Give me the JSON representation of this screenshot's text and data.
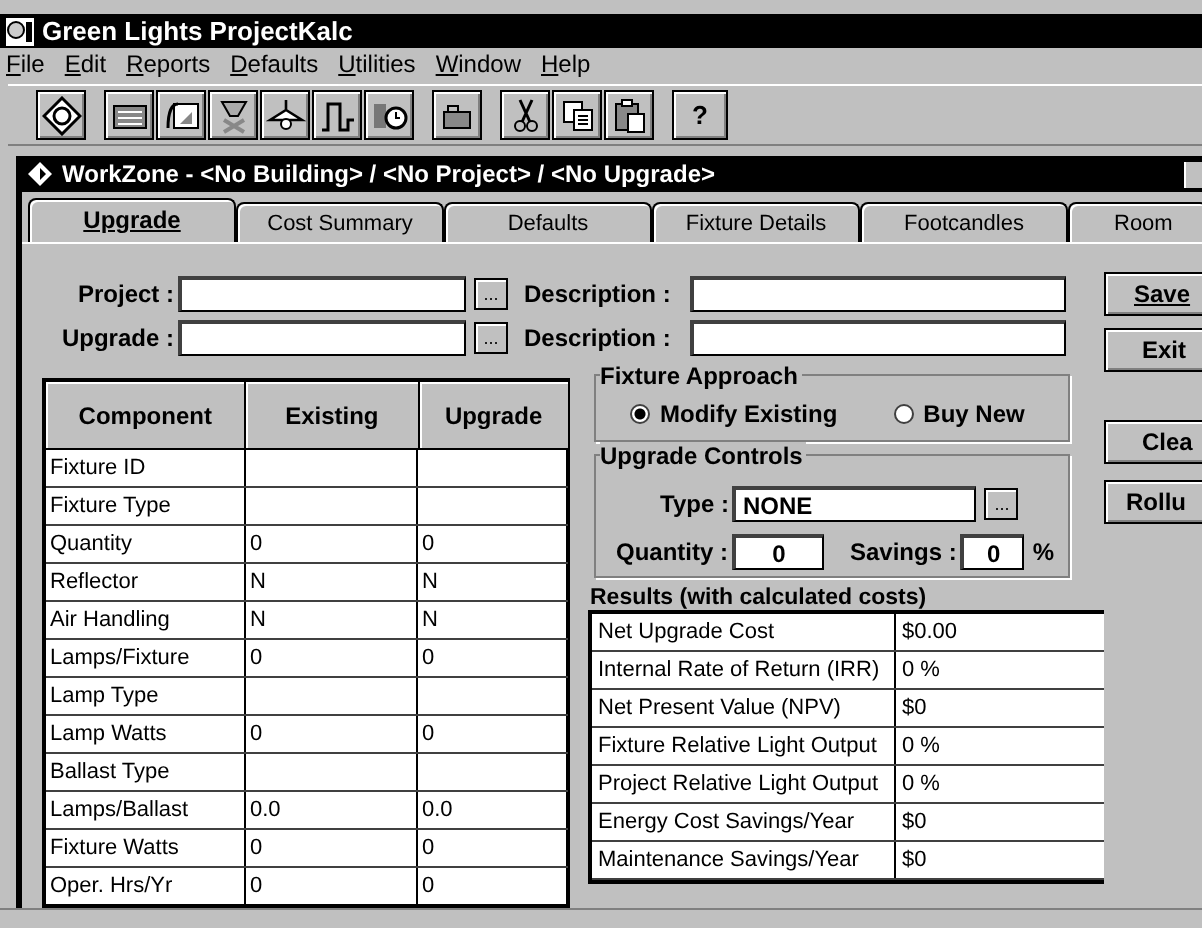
{
  "app": {
    "title": "Green Lights ProjectKalc"
  },
  "menu": [
    {
      "label": "File"
    },
    {
      "label": "Edit"
    },
    {
      "label": "Reports"
    },
    {
      "label": "Defaults"
    },
    {
      "label": "Utilities"
    },
    {
      "label": "Window"
    },
    {
      "label": "Help"
    }
  ],
  "toolbar": {
    "help": "?"
  },
  "workzone": {
    "title": "WorkZone - <No Building> / <No Project> / <No Upgrade>"
  },
  "tabs": [
    {
      "label": "Upgrade",
      "selected": true
    },
    {
      "label": "Cost Summary",
      "selected": false
    },
    {
      "label": "Defaults",
      "selected": false
    },
    {
      "label": "Fixture Details",
      "selected": false
    },
    {
      "label": "Footcandles",
      "selected": false
    },
    {
      "label": "Room",
      "selected": false
    }
  ],
  "form": [
    {
      "label": "Project :",
      "browse": "...",
      "desc_label": "Description :"
    },
    {
      "label": "Upgrade :",
      "browse": "...",
      "desc_label": "Description :"
    }
  ],
  "buttons": [
    {
      "label": "Save"
    },
    {
      "label": "Exit"
    },
    {
      "label": "Clea"
    },
    {
      "label": "Rollu"
    }
  ],
  "component_table": {
    "columns": [
      "Component",
      "Existing",
      "Upgrade"
    ],
    "rows": [
      {
        "component": "Fixture ID"
      },
      {
        "component": "Fixture Type"
      },
      {
        "component": "Quantity",
        "existing": "0",
        "upgrade": "0"
      },
      {
        "component": "Reflector",
        "existing": "N",
        "upgrade": "N"
      },
      {
        "component": "Air Handling",
        "existing": "N",
        "upgrade": "N"
      },
      {
        "component": "Lamps/Fixture",
        "existing": "0",
        "upgrade": "0"
      },
      {
        "component": "Lamp Type"
      },
      {
        "component": "Lamp Watts",
        "existing": "0",
        "upgrade": "0"
      },
      {
        "component": "Ballast Type"
      },
      {
        "component": "Lamps/Ballast",
        "existing": "0.0",
        "upgrade": "0.0"
      },
      {
        "component": "Fixture Watts",
        "existing": "0",
        "upgrade": "0"
      },
      {
        "component": "Oper. Hrs/Yr",
        "existing": "0",
        "upgrade": "0"
      }
    ]
  },
  "fixture_approach": {
    "title": "Fixture Approach",
    "options": [
      {
        "label": "Modify Existing",
        "selected": true
      },
      {
        "label": "Buy New",
        "selected": false
      }
    ]
  },
  "upgrade_controls": {
    "title": "Upgrade Controls",
    "type_label": "Type :",
    "type_value": "NONE",
    "browse": "...",
    "quantity_label": "Quantity :",
    "quantity_value": "0",
    "savings_label": "Savings :",
    "savings_value": "0",
    "savings_unit": "%"
  },
  "results": {
    "title": "Results (with calculated costs)",
    "rows": [
      {
        "label": "Net Upgrade Cost",
        "value": "$0.00"
      },
      {
        "label": "Internal Rate of Return (IRR)",
        "value": "0 %"
      },
      {
        "label": "Net Present Value (NPV)",
        "value": "$0"
      },
      {
        "label": "Fixture Relative Light Output",
        "value": "0 %"
      },
      {
        "label": "Project Relative Light Output",
        "value": "0 %"
      },
      {
        "label": "Energy Cost Savings/Year",
        "value": "$0"
      },
      {
        "label": "Maintenance Savings/Year",
        "value": "$0"
      }
    ]
  }
}
